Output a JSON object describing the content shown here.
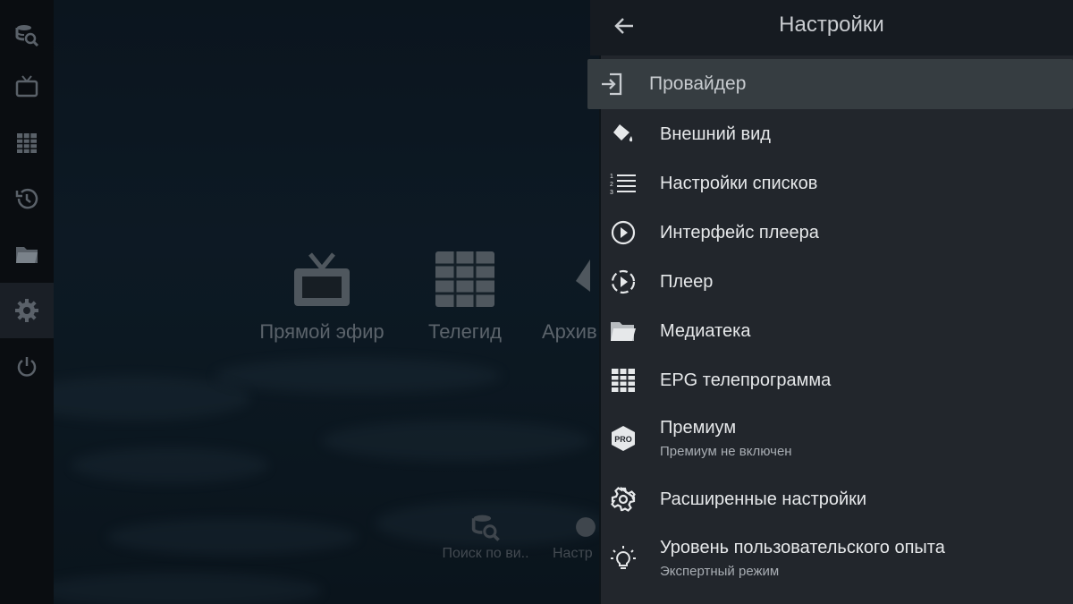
{
  "header": {
    "title": "Настройки",
    "back_icon": "arrow-back-icon"
  },
  "rail": {
    "items": [
      {
        "name": "search-video-icon",
        "active": false
      },
      {
        "name": "tv-icon",
        "active": false
      },
      {
        "name": "grid-icon",
        "active": false
      },
      {
        "name": "history-icon",
        "active": false
      },
      {
        "name": "folder-icon",
        "active": false
      },
      {
        "name": "gear-icon",
        "active": true
      },
      {
        "name": "power-icon",
        "active": false
      }
    ]
  },
  "home": {
    "tiles": [
      {
        "label": "Прямой эфир",
        "icon": "tv-icon"
      },
      {
        "label": "Телегид",
        "icon": "grid-icon"
      },
      {
        "label": "Архив",
        "icon": "archive-icon"
      }
    ],
    "bottom": [
      {
        "label": "Поиск по ви..",
        "icon": "search-video-icon"
      },
      {
        "label": "Настр",
        "icon": "gear-icon"
      }
    ]
  },
  "settings": {
    "items": [
      {
        "label": "Провайдер",
        "icon": "login-icon",
        "focused": true
      },
      {
        "label": "Внешний вид",
        "icon": "paint-bucket-icon"
      },
      {
        "label": "Настройки списков",
        "icon": "numbered-list-icon"
      },
      {
        "label": "Интерфейс плеера",
        "icon": "play-circle-icon"
      },
      {
        "label": "Плеер",
        "icon": "play-circle-dashed-icon"
      },
      {
        "label": "Медиатека",
        "icon": "folder-open-icon"
      },
      {
        "label": "EPG телепрограмма",
        "icon": "grid-icon"
      },
      {
        "label": "Премиум",
        "sublabel": "Премиум не включен",
        "icon": "pro-badge-icon"
      },
      {
        "label": "Расширенные настройки",
        "icon": "gear-icon"
      },
      {
        "label": "Уровень пользовательского опыта",
        "sublabel": "Экспертный режим",
        "icon": "lightbulb-icon"
      }
    ]
  },
  "colors": {
    "panel": "#22262c",
    "header": "#161b21",
    "focus": "#363d41",
    "text": "#e6e8ea",
    "subtext": "#a8adb3",
    "rail": "#0a0d11"
  }
}
